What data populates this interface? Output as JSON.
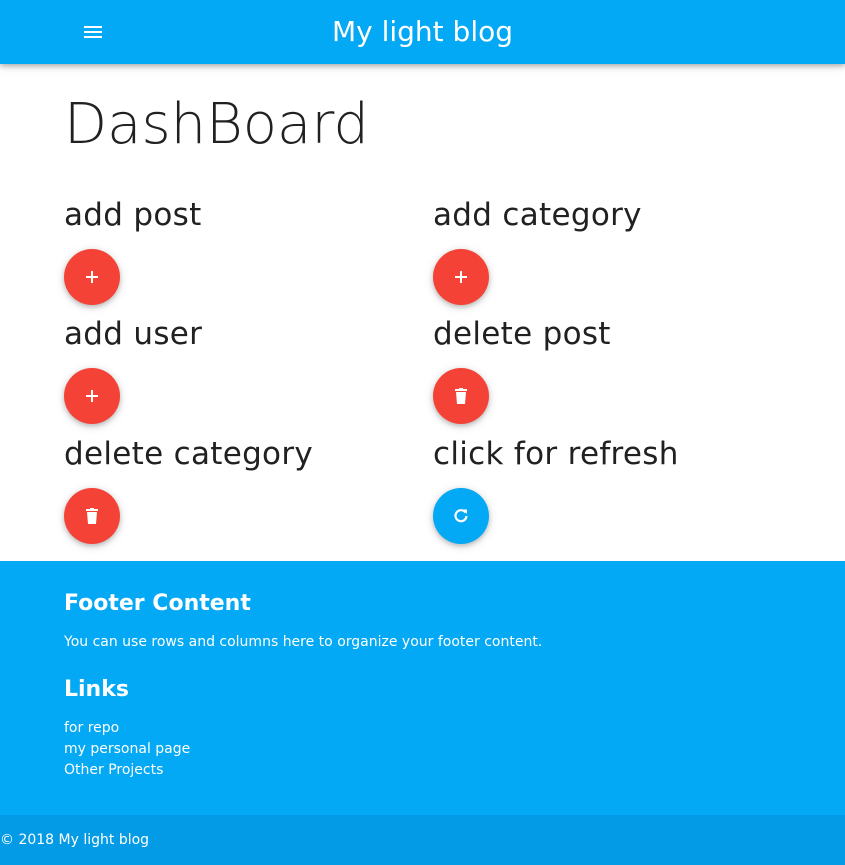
{
  "navbar": {
    "title": "My light blog",
    "menu_icon": "menu-icon"
  },
  "main": {
    "title": "DashBoard",
    "actions": [
      {
        "label": "add post",
        "icon": "add-icon",
        "color": "#f44336"
      },
      {
        "label": "add category",
        "icon": "add-icon",
        "color": "#f44336"
      },
      {
        "label": "add user",
        "icon": "add-icon",
        "color": "#f44336"
      },
      {
        "label": "delete post",
        "icon": "delete-icon",
        "color": "#f44336"
      },
      {
        "label": "delete category",
        "icon": "delete-icon",
        "color": "#f44336"
      },
      {
        "label": "click for refresh",
        "icon": "refresh-icon",
        "color": "#03a9f4"
      }
    ]
  },
  "footer": {
    "heading": "Footer Content",
    "text": "You can use rows and columns here to organize your footer content.",
    "links_heading": "Links",
    "links": [
      "for repo",
      "my personal page",
      "Other Projects"
    ],
    "copyright": "© 2018 My light blog"
  },
  "colors": {
    "primary": "#03a9f4",
    "primary_dark": "#039be5",
    "accent": "#f44336"
  }
}
